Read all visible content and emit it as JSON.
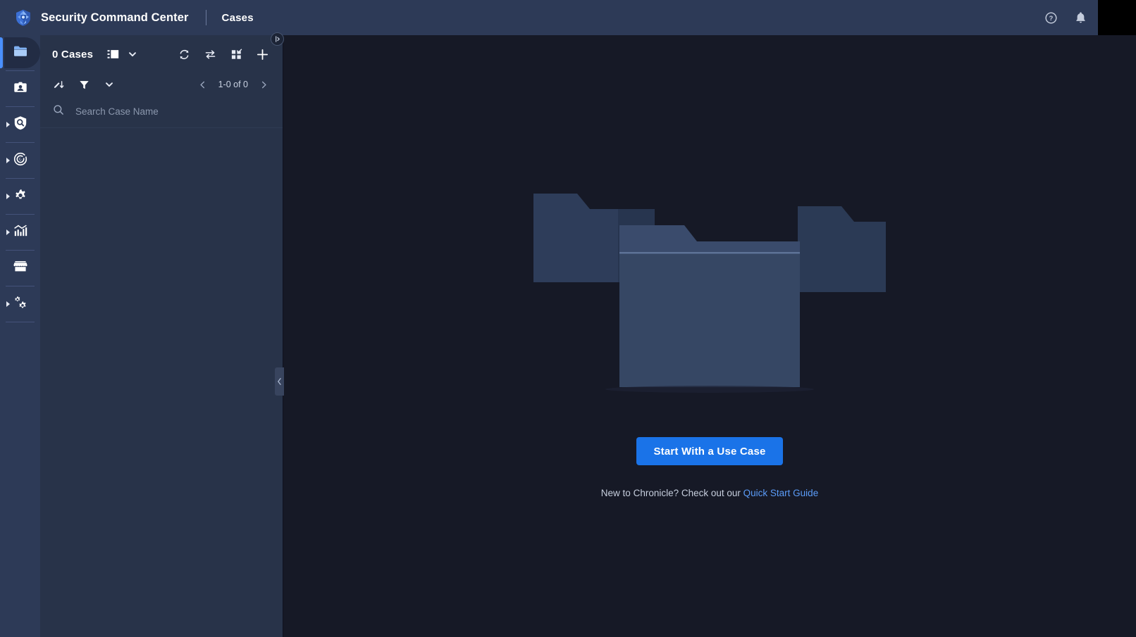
{
  "colors": {
    "topbar_bg": "#2d3a57",
    "rail_bg": "#2d3a57",
    "panel_bg": "#283349",
    "main_bg": "#161926",
    "accent_blue": "#1a73e8",
    "active_indicator": "#4a90ff",
    "link_blue": "#5b9cf8",
    "folder_front": "#364764",
    "folder_back": "#2b3a55"
  },
  "topbar": {
    "logo_icon": "shield-logo-icon",
    "brand": "Security Command Center",
    "page_title": "Cases",
    "actions": [
      {
        "icon": "help-icon",
        "name": "help-button"
      },
      {
        "icon": "bell-icon",
        "name": "notifications-button"
      }
    ],
    "avatar": {
      "name": "user-avatar",
      "label": ""
    }
  },
  "sidebar": {
    "items": [
      {
        "name": "sidebar-item-cases",
        "icon": "folder-icon",
        "active": true,
        "expandable": false
      },
      {
        "name": "sidebar-item-identity",
        "icon": "id-badge-icon",
        "active": false,
        "expandable": false
      },
      {
        "name": "sidebar-item-detection",
        "icon": "shield-search-icon",
        "active": false,
        "expandable": true
      },
      {
        "name": "sidebar-item-threats",
        "icon": "radar-target-icon",
        "active": false,
        "expandable": true
      },
      {
        "name": "sidebar-item-settings",
        "icon": "gear-icon",
        "active": false,
        "expandable": true
      },
      {
        "name": "sidebar-item-reports",
        "icon": "bar-chart-icon",
        "active": false,
        "expandable": true
      },
      {
        "name": "sidebar-item-marketplace",
        "icon": "storefront-icon",
        "active": false,
        "expandable": false
      },
      {
        "name": "sidebar-item-admin",
        "icon": "multi-gear-icon",
        "active": false,
        "expandable": true
      }
    ]
  },
  "cases_panel": {
    "count_label": "0 Cases",
    "view_mode_icon": "layout-view-icon",
    "view_mode_caret_icon": "chevron-down-icon",
    "toolbar_actions": [
      {
        "name": "refresh-button",
        "icon": "refresh-icon"
      },
      {
        "name": "transfer-button",
        "icon": "swap-arrows-icon"
      },
      {
        "name": "bulk-select-button",
        "icon": "grid-check-icon"
      },
      {
        "name": "add-case-button",
        "icon": "plus-icon"
      }
    ],
    "filter_actions": [
      {
        "name": "sort-button",
        "icon": "sort-icon"
      },
      {
        "name": "filter-button",
        "icon": "funnel-icon"
      },
      {
        "name": "more-filters-button",
        "icon": "chevron-down-icon"
      }
    ],
    "pagination": {
      "prev_icon": "chevron-left-icon",
      "label": "1-0 of 0",
      "next_icon": "chevron-right-icon"
    },
    "search": {
      "icon": "search-icon",
      "value": "",
      "placeholder": "Search Case Name"
    },
    "expand_handle": {
      "name": "panel-expand-handle",
      "icon": "expand-right-icon"
    },
    "collapse_tab": {
      "name": "panel-collapse-tab",
      "icon": "chevron-left-icon"
    }
  },
  "main": {
    "illustration": "empty-folders-illustration",
    "primary_button": "Start With a Use Case",
    "footer_prefix": "New to Chronicle? Check out our ",
    "footer_link": "Quick Start Guide"
  }
}
